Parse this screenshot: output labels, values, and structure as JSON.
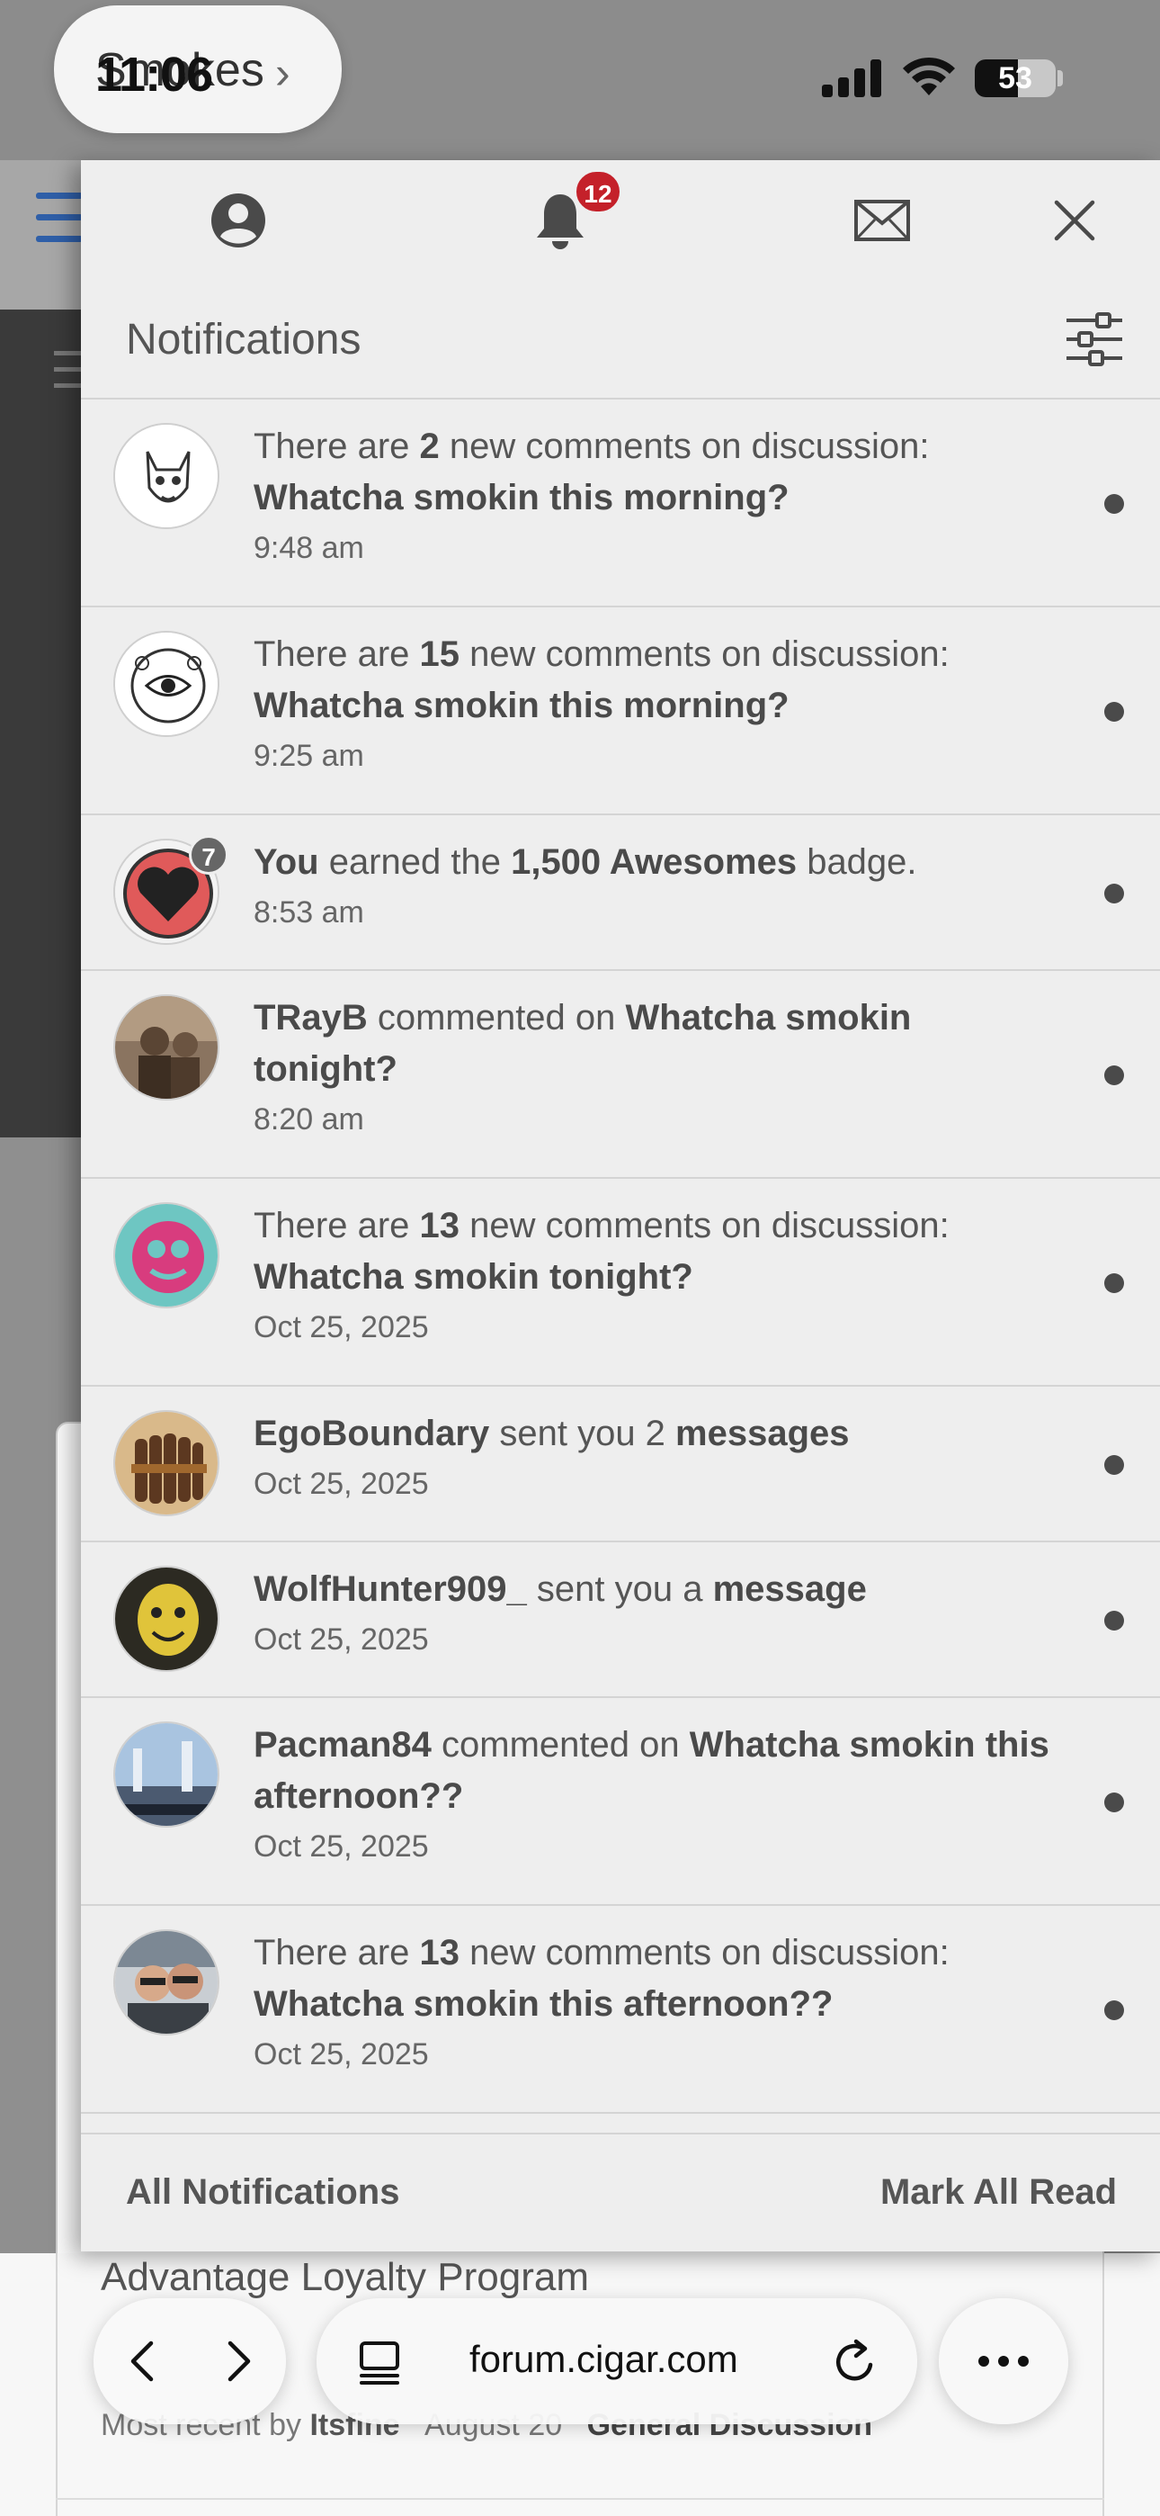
{
  "status_bar": {
    "time": "11:06",
    "app": "Smokes",
    "battery": "53",
    "battery_level": 0.53
  },
  "background_page": {
    "topic_title": "Advantage Loyalty Program",
    "meta_prefix": "Most recent by",
    "meta_user": "Itsfine",
    "meta_date": "August 20",
    "meta_category": "General Discussion"
  },
  "panel": {
    "bell_badge": "12",
    "title": "Notifications",
    "items": [
      {
        "parts": [
          [
            "There are ",
            false
          ],
          [
            "2",
            true
          ],
          [
            " new comments on discussion: ",
            false
          ],
          [
            "Whatcha smokin this morning?",
            true
          ]
        ],
        "time": "9:48 am",
        "avatar": "cat-sketch"
      },
      {
        "parts": [
          [
            "There are ",
            false
          ],
          [
            "15",
            true
          ],
          [
            " new comments on discussion: ",
            false
          ],
          [
            "Whatcha smokin this morning?",
            true
          ]
        ],
        "time": "9:25 am",
        "avatar": "eye-emblem"
      },
      {
        "parts": [
          [
            "You",
            true
          ],
          [
            " earned the ",
            false
          ],
          [
            "1,500 Awesomes",
            true
          ],
          [
            " badge.",
            false
          ]
        ],
        "time": "8:53 am",
        "avatar": "heart-badge",
        "badge_count": "7"
      },
      {
        "parts": [
          [
            "TRayB",
            true
          ],
          [
            " commented on ",
            false
          ],
          [
            "Whatcha smokin tonight?",
            true
          ]
        ],
        "time": "8:20 am",
        "avatar": "vintage-photo"
      },
      {
        "parts": [
          [
            "There are ",
            false
          ],
          [
            "13",
            true
          ],
          [
            " new comments on discussion: ",
            false
          ],
          [
            "Whatcha smokin tonight?",
            true
          ]
        ],
        "time": "Oct 25, 2025",
        "avatar": "pink-logo"
      },
      {
        "parts": [
          [
            "EgoBoundary",
            true
          ],
          [
            " sent you 2 ",
            false
          ],
          [
            "messages",
            true
          ]
        ],
        "time": "Oct 25, 2025",
        "avatar": "cigar-bundle"
      },
      {
        "parts": [
          [
            "WolfHunter909_",
            true
          ],
          [
            " sent you a ",
            false
          ],
          [
            "message",
            true
          ]
        ],
        "time": "Oct 25, 2025",
        "avatar": "yellow-mask"
      },
      {
        "parts": [
          [
            "Pacman84",
            true
          ],
          [
            " commented on ",
            false
          ],
          [
            "Whatcha smokin this afternoon??",
            true
          ]
        ],
        "time": "Oct 25, 2025",
        "avatar": "sky-photo"
      },
      {
        "parts": [
          [
            "There are ",
            false
          ],
          [
            "13",
            true
          ],
          [
            " new comments on discussion: ",
            false
          ],
          [
            "Whatcha smokin this afternoon??",
            true
          ]
        ],
        "time": "Oct 25, 2025",
        "avatar": "couple-selfie"
      }
    ],
    "footer_all": "All Notifications",
    "footer_mark": "Mark All Read"
  },
  "browser": {
    "url": "forum.cigar.com"
  },
  "colors": {
    "badge_red": "#c4212a",
    "panel_bg": "#eeeeee",
    "accent_blue": "#2f5fa8"
  }
}
